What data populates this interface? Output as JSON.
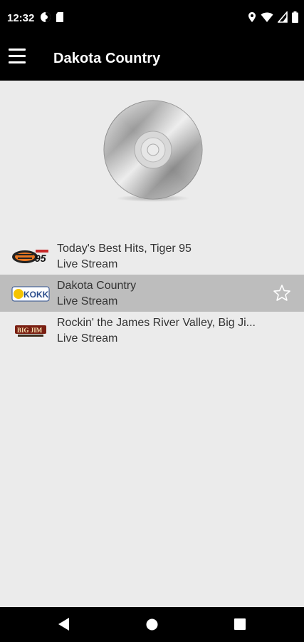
{
  "status_bar": {
    "time": "12:32"
  },
  "app_bar": {
    "title": "Dakota Country"
  },
  "stations": [
    {
      "title": "Today's Best Hits, Tiger 95",
      "subtitle": "Live Stream",
      "logo": "tiger-95-logo",
      "selected": false
    },
    {
      "title": "Dakota Country",
      "subtitle": "Live Stream",
      "logo": "kokk-logo",
      "selected": true
    },
    {
      "title": "Rockin' the James River Valley, Big Ji...",
      "subtitle": "Live Stream",
      "logo": "big-jim-logo",
      "selected": false
    }
  ],
  "colors": {
    "bar": "#000000",
    "background": "#ebebeb",
    "selected_row": "#bdbdbd"
  }
}
